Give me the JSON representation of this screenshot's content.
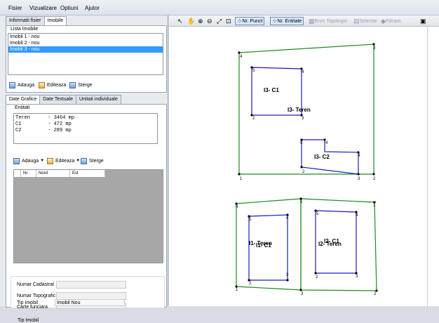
{
  "menu": [
    "Fisier",
    "Vizualizare",
    "Optiuni",
    "Ajutor"
  ],
  "left_tabs": [
    "Informatii fisier",
    "Imobile"
  ],
  "lista_imobile": {
    "title": "Lista Imobile",
    "items": [
      "Imobil 1 - nou",
      "Imobil 2 - nou",
      "Imobil 3 - nou"
    ],
    "selected": 2
  },
  "actions": {
    "add": "Adauga",
    "edit": "Editeaza",
    "delete": "Sterge"
  },
  "detail_tabs": [
    "Date Grafice",
    "Date Textuale",
    "Unitati individuale"
  ],
  "entitati": {
    "title": "Entitati",
    "lines": [
      "Teren      - 3464 mp",
      "C1         - 472 mp",
      "C2         - 289 mp"
    ]
  },
  "grid_headers": [
    "Nr.",
    "Nord",
    "Est"
  ],
  "fields": [
    {
      "label": "Numar Cadastral",
      "value": ""
    },
    {
      "label": "Numar Topografic",
      "value": ""
    },
    {
      "label": "Carte funciara",
      "value": ""
    },
    {
      "label": "Tip Imobil",
      "value": "Imobil Nou"
    }
  ],
  "toolbar": {
    "nr_punct": "Nr. Punct",
    "nr_entitate": "Nr. Entitate",
    "erori": "Erori Topologie",
    "selectie": "Selectie",
    "filtrare": "Filtrare"
  },
  "drawing": {
    "labels": {
      "i3_c1": "I3- C1",
      "i3_teren": "I3- Teren",
      "i3_c2": "I3- C2",
      "i1_teren": "I1- Teren",
      "i1_c1": "I1- C1",
      "i2_c1": "I2- C1",
      "i2_teren": "I2- Teren"
    },
    "colors": {
      "teren": "#1e8a1e",
      "constructie": "#1a1ac8"
    }
  }
}
